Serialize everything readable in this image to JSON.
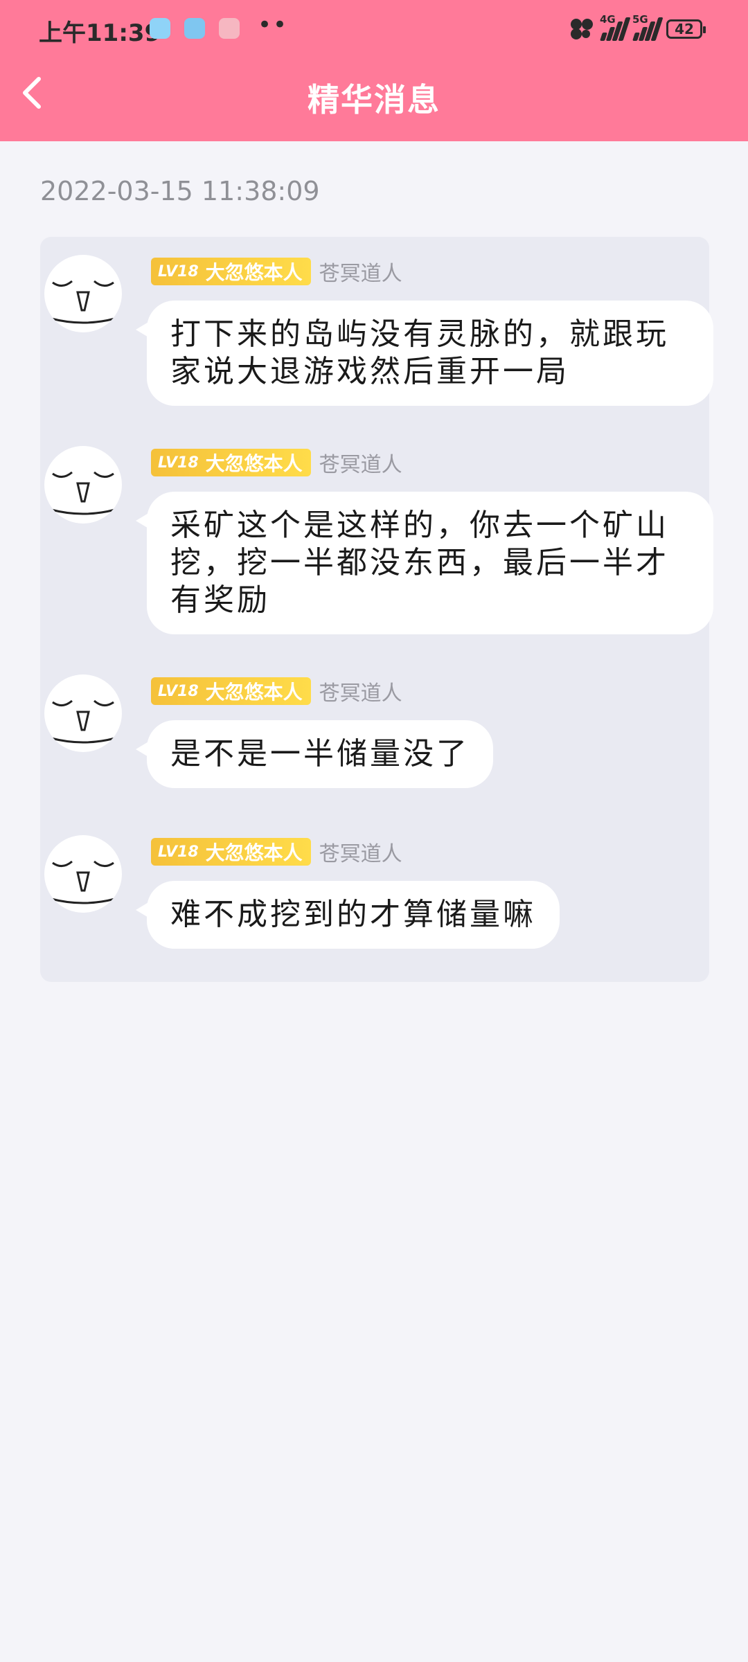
{
  "status_bar": {
    "time": "上午11:39",
    "network_4g": "4G",
    "network_5g": "5G",
    "battery": "42"
  },
  "header": {
    "title": "精华消息",
    "back_icon": "chevron-left-icon"
  },
  "timestamp": "2022-03-15 11:38:09",
  "messages": [
    {
      "level": "LV18",
      "badge_title": "大忽悠本人",
      "nickname": "苍冥道人",
      "text": "打下来的岛屿没有灵脉的，就跟玩家说大退游戏然后重开一局"
    },
    {
      "level": "LV18",
      "badge_title": "大忽悠本人",
      "nickname": "苍冥道人",
      "text": "采矿这个是这样的，你去一个矿山挖，挖一半都没东西，最后一半才有奖励"
    },
    {
      "level": "LV18",
      "badge_title": "大忽悠本人",
      "nickname": "苍冥道人",
      "text": "是不是一半储量没了"
    },
    {
      "level": "LV18",
      "badge_title": "大忽悠本人",
      "nickname": "苍冥道人",
      "text": "难不成挖到的才算储量嘛"
    }
  ],
  "colors": {
    "header": "#ff7a99",
    "background": "#f4f4f9",
    "panel": "#e9eaf2",
    "badge": "#f7c53d"
  }
}
